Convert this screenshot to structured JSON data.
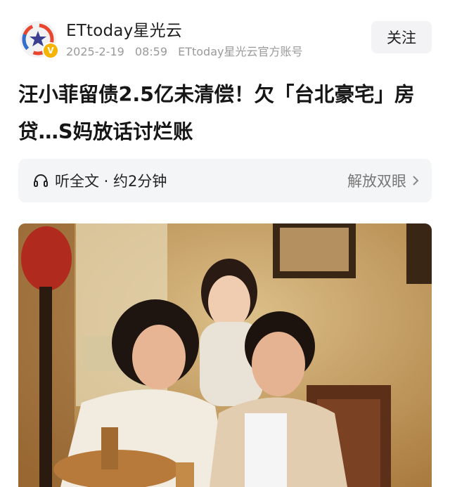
{
  "account": {
    "name": "ETtoday星光云",
    "date": "2025-2-19",
    "time": "08:59",
    "source": "ETtoday星光云官方账号",
    "follow_label": "关注",
    "avatar_icon": "star-logo-icon",
    "verified_icon": "verified-v-icon"
  },
  "article": {
    "title": "汪小菲留债2.5亿未清偿！欠「台北豪宅」房贷…S妈放话讨烂账"
  },
  "listen": {
    "icon": "headphone-icon",
    "label": "听全文 · 约2分钟",
    "action_label": "解放双眼",
    "action_icon": "chevron-right-icon"
  },
  "photo": {
    "description_icon": "photo-image"
  },
  "colors": {
    "background": "#ffffff",
    "meta_text": "#9a9a9a",
    "button_bg": "#f3f3f5",
    "listen_bg": "#f4f5f7",
    "verified": "#f5b400"
  }
}
